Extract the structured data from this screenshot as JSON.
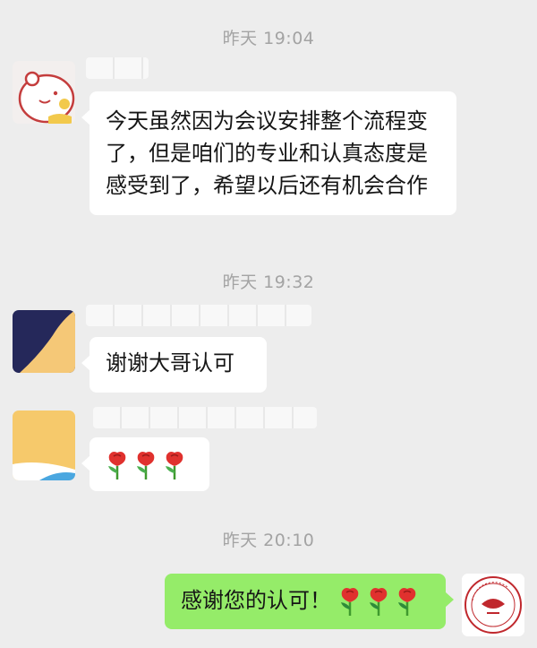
{
  "messages": [
    {
      "time": "昨天 19:04",
      "sender": "contact",
      "text": "今天虽然因为会议安排整个流程变了，但是咱们的专业和认真态度是感受到了，希望以后还有机会合作"
    },
    {
      "time": "昨天 19:32",
      "sender": "me",
      "text": "谢谢大哥认可"
    },
    {
      "sender": "me",
      "emoji": [
        "rose-icon",
        "rose-icon",
        "rose-icon"
      ]
    },
    {
      "time": "昨天 20:10",
      "sender": "me",
      "text": "感谢您的认可！",
      "emoji": [
        "rose-icon",
        "rose-icon",
        "rose-icon"
      ]
    }
  ],
  "colors": {
    "background": "#ededed",
    "incoming_bubble": "#ffffff",
    "outgoing_bubble": "#95ec69",
    "timestamp": "#a3a3a3"
  }
}
